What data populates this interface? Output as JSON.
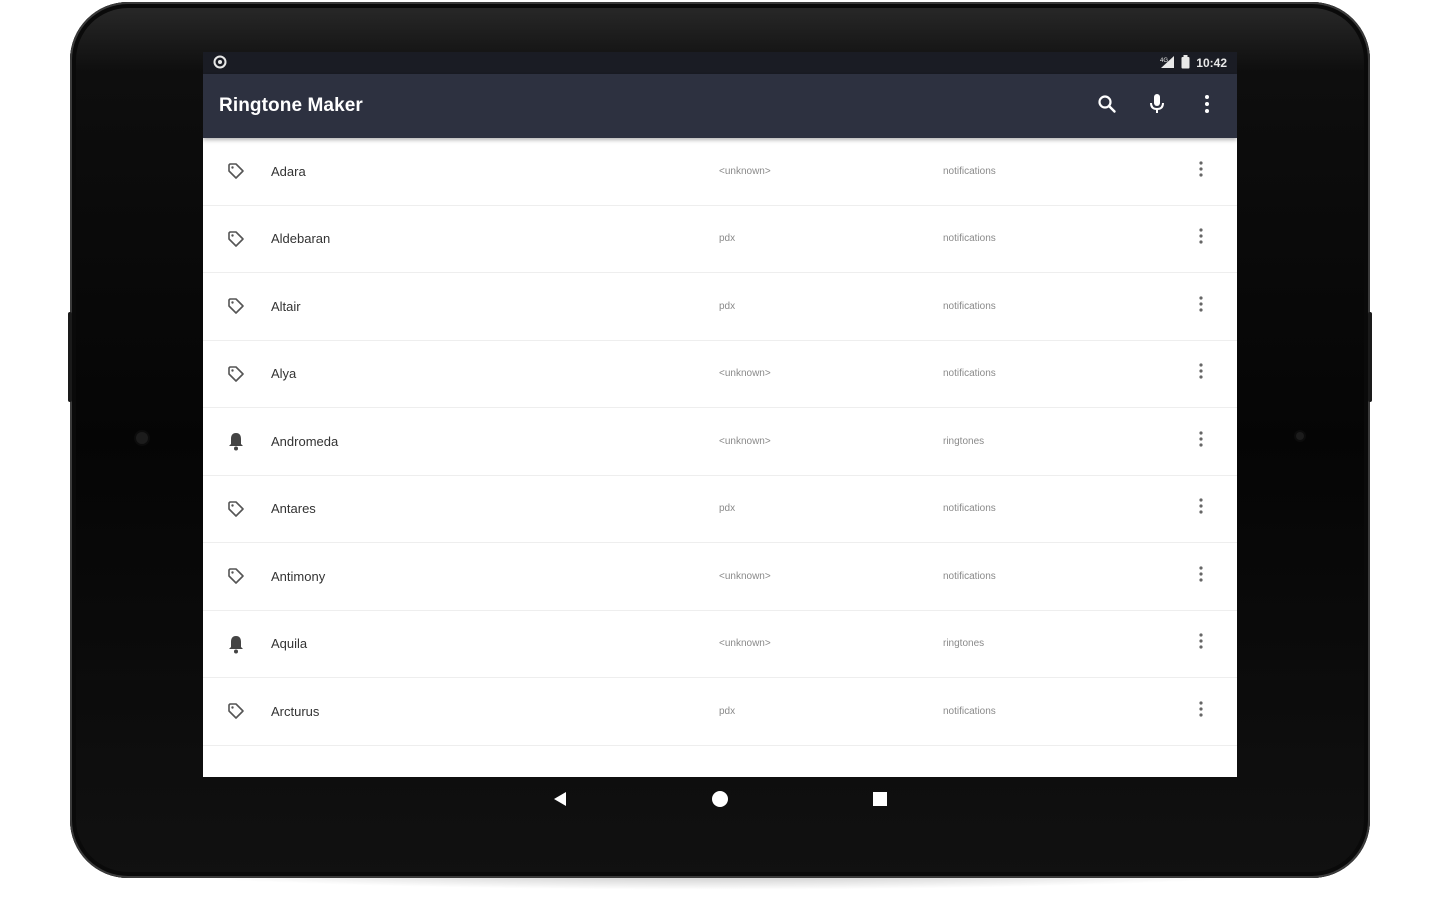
{
  "status_bar": {
    "time": "10:42",
    "icons": [
      "settings-icon",
      "signal-icon",
      "battery-icon"
    ]
  },
  "toolbar": {
    "title": "Ringtone Maker",
    "actions": [
      "search-icon",
      "microphone-icon",
      "overflow-menu-icon"
    ]
  },
  "colors": {
    "status_bar_bg": "#1a1c24",
    "toolbar_bg": "#2d3140",
    "list_bg": "#ffffff",
    "primary_text": "#333333",
    "secondary_text": "#8a8a8a"
  },
  "sounds": [
    {
      "name": "Adara",
      "artist": "<unknown>",
      "album": "notifications",
      "icon": "tag-icon"
    },
    {
      "name": "Aldebaran",
      "artist": "pdx",
      "album": "notifications",
      "icon": "tag-icon"
    },
    {
      "name": "Altair",
      "artist": "pdx",
      "album": "notifications",
      "icon": "tag-icon"
    },
    {
      "name": "Alya",
      "artist": "<unknown>",
      "album": "notifications",
      "icon": "tag-icon"
    },
    {
      "name": "Andromeda",
      "artist": "<unknown>",
      "album": "ringtones",
      "icon": "bell-icon"
    },
    {
      "name": "Antares",
      "artist": "pdx",
      "album": "notifications",
      "icon": "tag-icon"
    },
    {
      "name": "Antimony",
      "artist": "<unknown>",
      "album": "notifications",
      "icon": "tag-icon"
    },
    {
      "name": "Aquila",
      "artist": "<unknown>",
      "album": "ringtones",
      "icon": "bell-icon"
    },
    {
      "name": "Arcturus",
      "artist": "pdx",
      "album": "notifications",
      "icon": "tag-icon"
    }
  ],
  "nav_bar": [
    "back-icon",
    "home-icon",
    "recents-icon"
  ]
}
